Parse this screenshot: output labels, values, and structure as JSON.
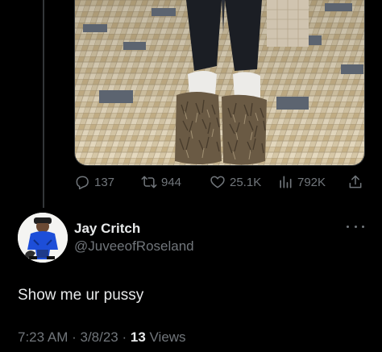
{
  "tweet_actions": {
    "replies": "137",
    "retweets": "944",
    "likes": "25.1K",
    "views": "792K"
  },
  "icons": {
    "reply": "reply-icon",
    "retweet": "retweet-icon",
    "like": "heart-icon",
    "views": "analytics-icon",
    "share": "share-icon",
    "more": "more-icon"
  },
  "reply_tweet": {
    "display_name": "Jay Critch",
    "handle": "@JuveeofRoseland",
    "text": "Show me ur pussy",
    "time": "7:23 AM",
    "separator": " · ",
    "date": "3/8/23",
    "separator2": " · ",
    "views_count": "13",
    "views_label": " Views"
  },
  "colors": {
    "background": "#000000",
    "primary_text": "#e7e9ea",
    "secondary_text": "#71767b",
    "divider": "#2f3336",
    "avatar_jacket": "#1d4ed8"
  }
}
